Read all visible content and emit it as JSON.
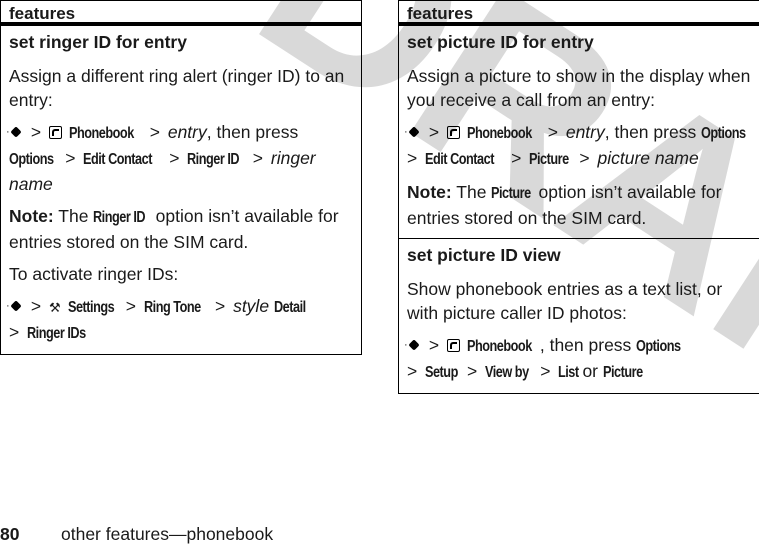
{
  "watermark": "DRAFT",
  "left_table": {
    "header": "features",
    "rows": [
      {
        "title": "set ringer ID for entry",
        "intro": "Assign a different ring alert (ringer ID) to an entry:",
        "path1": {
          "icon1": "nav-key-icon",
          "phonebook": "Phonebook",
          "entry": "entry",
          "then": ", then press",
          "options": "Options",
          "edit": "Edit Contact",
          "ringer": "Ringer ID",
          "ringer_name": "ringer name"
        },
        "note_label": "Note:",
        "note_the": "The",
        "note_key": "Ringer ID",
        "note_rest": "option isn’t available for entries stored on the SIM card.",
        "activate": "To activate ringer IDs:",
        "path2": {
          "settings": "Settings",
          "ringtone": "Ring Tone",
          "style": "style",
          "detail": "Detail",
          "ringerids": "Ringer IDs"
        }
      }
    ]
  },
  "right_table": {
    "header": "features",
    "rows": [
      {
        "title": "set picture ID for entry",
        "intro": "Assign a picture to show in the display when you receive a call from an entry:",
        "path": {
          "phonebook": "Phonebook",
          "entry": "entry",
          "then": ", then press",
          "options": "Options",
          "edit": "Edit Contact",
          "picture": "Picture",
          "picture_name": "picture name"
        },
        "note_label": "Note:",
        "note_the": "The",
        "note_key": "Picture",
        "note_rest": "option isn’t available for entries stored on the SIM card."
      },
      {
        "title": "set picture ID view",
        "intro": "Show phonebook entries as a text list, or with picture caller ID photos:",
        "path": {
          "phonebook": "Phonebook",
          "then": ", then press",
          "options": "Options",
          "setup": "Setup",
          "viewby": "View by",
          "list": "List",
          "or": "or",
          "picture": "Picture"
        }
      }
    ]
  },
  "footer": {
    "page_number": "80",
    "running_title": "other features—phonebook"
  },
  "symbols": {
    "gt": ">"
  }
}
